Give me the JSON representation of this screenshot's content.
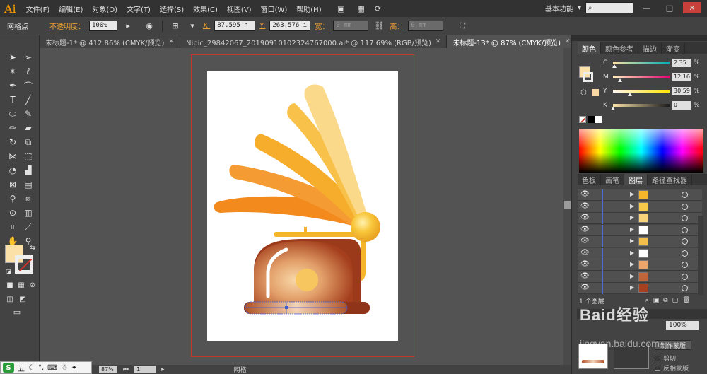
{
  "app": {
    "logo": "Ai"
  },
  "menu": {
    "items": [
      "文件(F)",
      "编辑(E)",
      "对象(O)",
      "文字(T)",
      "选择(S)",
      "效果(C)",
      "视图(V)",
      "窗口(W)",
      "帮助(H)"
    ],
    "workspace": "基本功能",
    "workspace_arrow": "▾"
  },
  "control": {
    "object_label": "网格点",
    "opacity_label": "不透明度：",
    "opacity_value": "100%",
    "x_label": "X:",
    "x_value": "87.595 n",
    "y_label": "Y:",
    "y_value": "263.576 i",
    "w_label": "宽：",
    "w_value": "0 mm",
    "h_label": "高：",
    "h_value": "0 mm"
  },
  "tabs": [
    {
      "label": "未标题-1* @ 412.86% (CMYK/预览)",
      "active": false
    },
    {
      "label": "Nipic_29842067_20190910102324767000.ai* @ 117.69% (RGB/预览)",
      "active": false
    },
    {
      "label": "未标题-13* @ 87% (CMYK/预览)",
      "active": true
    }
  ],
  "tab_close_glyph": "✕",
  "color_panel": {
    "tabs": [
      "颜色",
      "颜色参考",
      "描边",
      "渐变"
    ],
    "channels": [
      {
        "letter": "C",
        "value": "2.35",
        "fraction": 0.0235
      },
      {
        "letter": "M",
        "value": "12.16",
        "fraction": 0.1216
      },
      {
        "letter": "Y",
        "value": "30.59",
        "fraction": 0.3059
      },
      {
        "letter": "K",
        "value": "0",
        "fraction": 0.0
      }
    ],
    "percent": "%",
    "fill_color": "#fbe1a7"
  },
  "layers_panel": {
    "tabs": [
      "色板",
      "画笔",
      "图层",
      "路径查找器"
    ],
    "rows": [
      {
        "thumb": "#f4b52b"
      },
      {
        "thumb": "#f7c94b"
      },
      {
        "thumb": "#f8d27a"
      },
      {
        "thumb": "#ffffff"
      },
      {
        "thumb": "#f2c04a"
      },
      {
        "thumb": "#ffffff"
      },
      {
        "thumb": "#e9a56a"
      },
      {
        "thumb": "#c0653a"
      },
      {
        "thumb": "#a6401e"
      }
    ],
    "footer": "1 个图层"
  },
  "transparency": {
    "opacity_value": "100%",
    "make_mask": "制作蒙版",
    "clip": "剪切",
    "invert": "反相蒙版"
  },
  "status": {
    "zoom_value": "87%",
    "page_value": "1",
    "tool_label": "网格"
  },
  "ime": {
    "logo": "S",
    "label": "五"
  },
  "watermark": {
    "text": "Baid经验",
    "sub": "jingyan.baidu.com"
  }
}
